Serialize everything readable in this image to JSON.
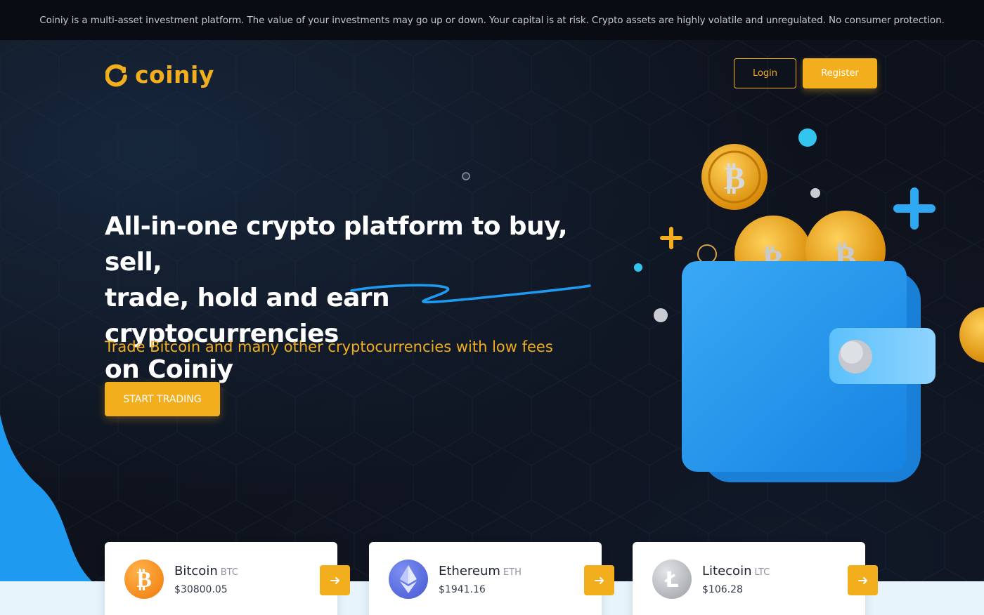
{
  "disclaimer": "Coiniy is a multi-asset investment platform. The value of your investments may go up or down. Your capital is at risk. Crypto assets are highly volatile and unregulated. No consumer protection.",
  "brand": {
    "name": "coiniy",
    "accent": "#f2ae1c",
    "blue": "#1e9bf0"
  },
  "header": {
    "login_label": "Login",
    "register_label": "Register"
  },
  "hero": {
    "headline_line1": "All-in-one crypto platform to buy, sell,",
    "headline_line2": "trade, hold and earn cryptocurrencies",
    "headline_line3": "on Coiniy",
    "subline": "Trade Bitcoin and many other cryptocurrencies with low fees",
    "cta_label": "START TRADING"
  },
  "coins": [
    {
      "name": "Bitcoin",
      "symbol": "BTC",
      "price": "$30800.05",
      "icon": "bitcoin-icon",
      "color": "#f7931a"
    },
    {
      "name": "Ethereum",
      "symbol": "ETH",
      "price": "$1941.16",
      "icon": "ethereum-icon",
      "color": "#5b6fe0"
    },
    {
      "name": "Litecoin",
      "symbol": "LTC",
      "price": "$106.28",
      "icon": "litecoin-icon",
      "color": "#a6a9ae"
    }
  ]
}
